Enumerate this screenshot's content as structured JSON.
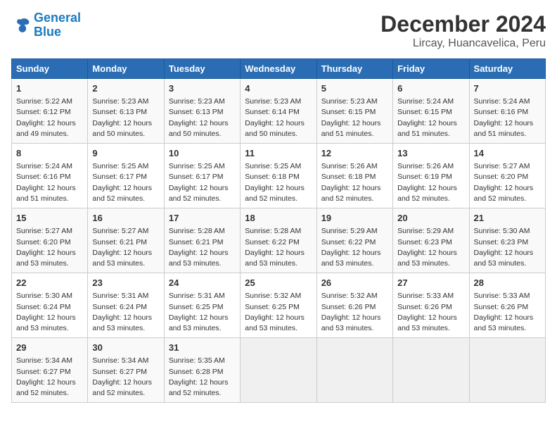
{
  "header": {
    "logo_line1": "General",
    "logo_line2": "Blue",
    "title": "December 2024",
    "subtitle": "Lircay, Huancavelica, Peru"
  },
  "calendar": {
    "weekdays": [
      "Sunday",
      "Monday",
      "Tuesday",
      "Wednesday",
      "Thursday",
      "Friday",
      "Saturday"
    ],
    "weeks": [
      [
        {
          "day": "",
          "empty": true
        },
        {
          "day": "",
          "empty": true
        },
        {
          "day": "",
          "empty": true
        },
        {
          "day": "",
          "empty": true
        },
        {
          "day": "",
          "empty": true
        },
        {
          "day": "",
          "empty": true
        },
        {
          "day": "",
          "empty": true
        }
      ],
      [
        {
          "day": "1",
          "sunrise": "Sunrise: 5:22 AM",
          "sunset": "Sunset: 6:12 PM",
          "daylight": "Daylight: 12 hours and 49 minutes."
        },
        {
          "day": "2",
          "sunrise": "Sunrise: 5:23 AM",
          "sunset": "Sunset: 6:13 PM",
          "daylight": "Daylight: 12 hours and 50 minutes."
        },
        {
          "day": "3",
          "sunrise": "Sunrise: 5:23 AM",
          "sunset": "Sunset: 6:13 PM",
          "daylight": "Daylight: 12 hours and 50 minutes."
        },
        {
          "day": "4",
          "sunrise": "Sunrise: 5:23 AM",
          "sunset": "Sunset: 6:14 PM",
          "daylight": "Daylight: 12 hours and 50 minutes."
        },
        {
          "day": "5",
          "sunrise": "Sunrise: 5:23 AM",
          "sunset": "Sunset: 6:15 PM",
          "daylight": "Daylight: 12 hours and 51 minutes."
        },
        {
          "day": "6",
          "sunrise": "Sunrise: 5:24 AM",
          "sunset": "Sunset: 6:15 PM",
          "daylight": "Daylight: 12 hours and 51 minutes."
        },
        {
          "day": "7",
          "sunrise": "Sunrise: 5:24 AM",
          "sunset": "Sunset: 6:16 PM",
          "daylight": "Daylight: 12 hours and 51 minutes."
        }
      ],
      [
        {
          "day": "8",
          "sunrise": "Sunrise: 5:24 AM",
          "sunset": "Sunset: 6:16 PM",
          "daylight": "Daylight: 12 hours and 51 minutes."
        },
        {
          "day": "9",
          "sunrise": "Sunrise: 5:25 AM",
          "sunset": "Sunset: 6:17 PM",
          "daylight": "Daylight: 12 hours and 52 minutes."
        },
        {
          "day": "10",
          "sunrise": "Sunrise: 5:25 AM",
          "sunset": "Sunset: 6:17 PM",
          "daylight": "Daylight: 12 hours and 52 minutes."
        },
        {
          "day": "11",
          "sunrise": "Sunrise: 5:25 AM",
          "sunset": "Sunset: 6:18 PM",
          "daylight": "Daylight: 12 hours and 52 minutes."
        },
        {
          "day": "12",
          "sunrise": "Sunrise: 5:26 AM",
          "sunset": "Sunset: 6:18 PM",
          "daylight": "Daylight: 12 hours and 52 minutes."
        },
        {
          "day": "13",
          "sunrise": "Sunrise: 5:26 AM",
          "sunset": "Sunset: 6:19 PM",
          "daylight": "Daylight: 12 hours and 52 minutes."
        },
        {
          "day": "14",
          "sunrise": "Sunrise: 5:27 AM",
          "sunset": "Sunset: 6:20 PM",
          "daylight": "Daylight: 12 hours and 52 minutes."
        }
      ],
      [
        {
          "day": "15",
          "sunrise": "Sunrise: 5:27 AM",
          "sunset": "Sunset: 6:20 PM",
          "daylight": "Daylight: 12 hours and 53 minutes."
        },
        {
          "day": "16",
          "sunrise": "Sunrise: 5:27 AM",
          "sunset": "Sunset: 6:21 PM",
          "daylight": "Daylight: 12 hours and 53 minutes."
        },
        {
          "day": "17",
          "sunrise": "Sunrise: 5:28 AM",
          "sunset": "Sunset: 6:21 PM",
          "daylight": "Daylight: 12 hours and 53 minutes."
        },
        {
          "day": "18",
          "sunrise": "Sunrise: 5:28 AM",
          "sunset": "Sunset: 6:22 PM",
          "daylight": "Daylight: 12 hours and 53 minutes."
        },
        {
          "day": "19",
          "sunrise": "Sunrise: 5:29 AM",
          "sunset": "Sunset: 6:22 PM",
          "daylight": "Daylight: 12 hours and 53 minutes."
        },
        {
          "day": "20",
          "sunrise": "Sunrise: 5:29 AM",
          "sunset": "Sunset: 6:23 PM",
          "daylight": "Daylight: 12 hours and 53 minutes."
        },
        {
          "day": "21",
          "sunrise": "Sunrise: 5:30 AM",
          "sunset": "Sunset: 6:23 PM",
          "daylight": "Daylight: 12 hours and 53 minutes."
        }
      ],
      [
        {
          "day": "22",
          "sunrise": "Sunrise: 5:30 AM",
          "sunset": "Sunset: 6:24 PM",
          "daylight": "Daylight: 12 hours and 53 minutes."
        },
        {
          "day": "23",
          "sunrise": "Sunrise: 5:31 AM",
          "sunset": "Sunset: 6:24 PM",
          "daylight": "Daylight: 12 hours and 53 minutes."
        },
        {
          "day": "24",
          "sunrise": "Sunrise: 5:31 AM",
          "sunset": "Sunset: 6:25 PM",
          "daylight": "Daylight: 12 hours and 53 minutes."
        },
        {
          "day": "25",
          "sunrise": "Sunrise: 5:32 AM",
          "sunset": "Sunset: 6:25 PM",
          "daylight": "Daylight: 12 hours and 53 minutes."
        },
        {
          "day": "26",
          "sunrise": "Sunrise: 5:32 AM",
          "sunset": "Sunset: 6:26 PM",
          "daylight": "Daylight: 12 hours and 53 minutes."
        },
        {
          "day": "27",
          "sunrise": "Sunrise: 5:33 AM",
          "sunset": "Sunset: 6:26 PM",
          "daylight": "Daylight: 12 hours and 53 minutes."
        },
        {
          "day": "28",
          "sunrise": "Sunrise: 5:33 AM",
          "sunset": "Sunset: 6:26 PM",
          "daylight": "Daylight: 12 hours and 53 minutes."
        }
      ],
      [
        {
          "day": "29",
          "sunrise": "Sunrise: 5:34 AM",
          "sunset": "Sunset: 6:27 PM",
          "daylight": "Daylight: 12 hours and 52 minutes."
        },
        {
          "day": "30",
          "sunrise": "Sunrise: 5:34 AM",
          "sunset": "Sunset: 6:27 PM",
          "daylight": "Daylight: 12 hours and 52 minutes."
        },
        {
          "day": "31",
          "sunrise": "Sunrise: 5:35 AM",
          "sunset": "Sunset: 6:28 PM",
          "daylight": "Daylight: 12 hours and 52 minutes."
        },
        {
          "day": "",
          "empty": true
        },
        {
          "day": "",
          "empty": true
        },
        {
          "day": "",
          "empty": true
        },
        {
          "day": "",
          "empty": true
        }
      ]
    ]
  }
}
